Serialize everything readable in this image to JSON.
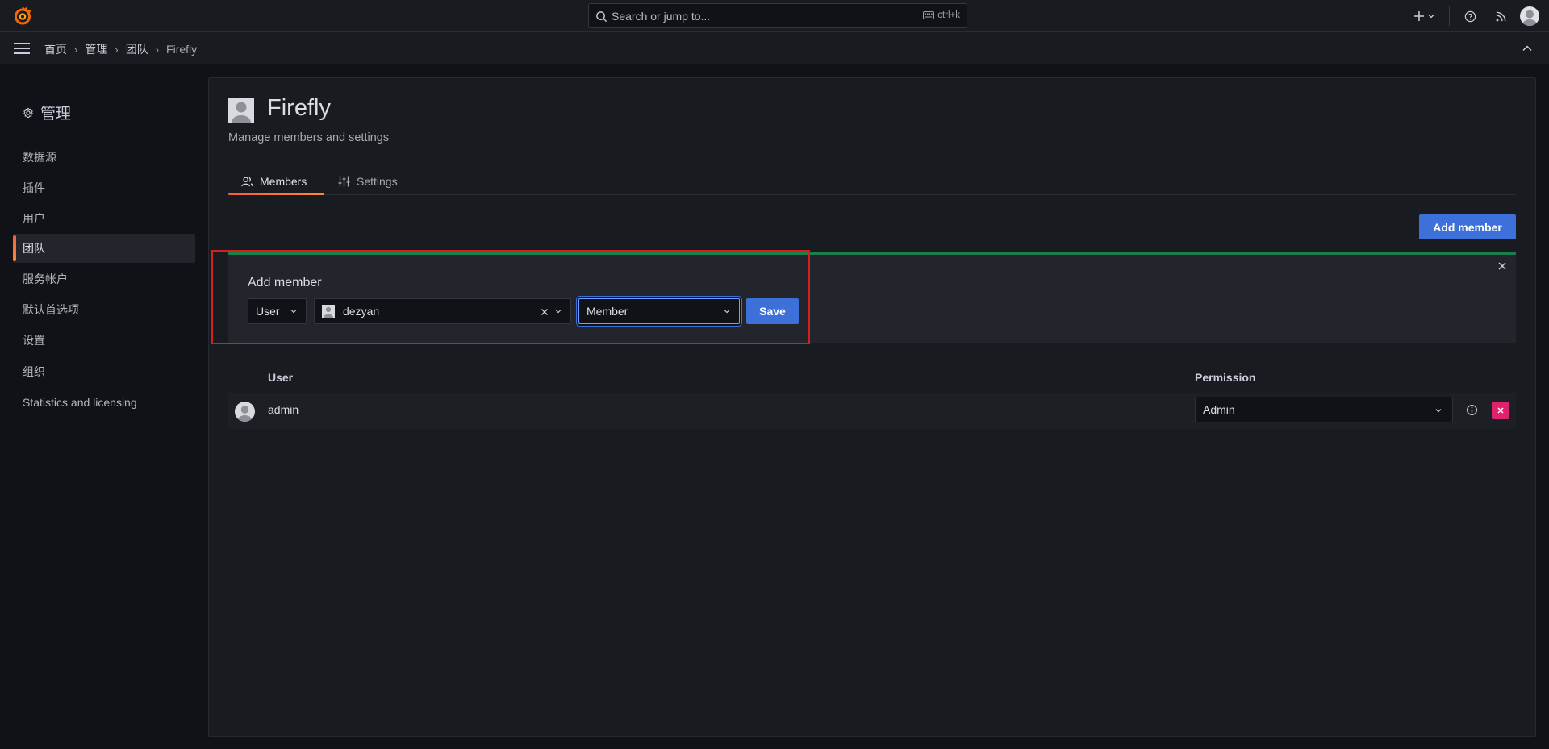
{
  "topbar": {
    "search_placeholder": "Search or jump to...",
    "search_shortcut": "ctrl+k",
    "icons": [
      "grafana-logo-icon",
      "search-icon",
      "keyboard-icon",
      "plus-icon",
      "chevron-down-icon",
      "help-icon",
      "news-feed-icon",
      "user-avatar-icon"
    ]
  },
  "breadcrumb": {
    "items": [
      "首页",
      "管理",
      "团队",
      "Firefly"
    ]
  },
  "sidebar": {
    "title": "管理",
    "items": [
      {
        "label": "数据源",
        "active": false
      },
      {
        "label": "插件",
        "active": false
      },
      {
        "label": "用户",
        "active": false
      },
      {
        "label": "团队",
        "active": true
      },
      {
        "label": "服务帐户",
        "active": false
      },
      {
        "label": "默认首选项",
        "active": false
      },
      {
        "label": "设置",
        "active": false
      },
      {
        "label": "组织",
        "active": false
      },
      {
        "label": "Statistics and licensing",
        "active": false
      }
    ]
  },
  "page": {
    "title": "Firefly",
    "subtitle": "Manage members and settings",
    "tabs": [
      {
        "label": "Members",
        "active": true
      },
      {
        "label": "Settings",
        "active": false
      }
    ],
    "add_member_button": "Add member"
  },
  "add_member_form": {
    "title": "Add member",
    "type_value": "User",
    "user_value": "dezyan",
    "role_value": "Member",
    "save_label": "Save"
  },
  "members_table": {
    "columns": [
      "User",
      "Permission"
    ],
    "rows": [
      {
        "user": "admin",
        "permission": "Admin"
      }
    ]
  },
  "colors": {
    "accent_orange": "#f55f3e",
    "primary_blue": "#3d71d9",
    "success_green": "#1a7f4b",
    "danger_pink": "#e0226e",
    "highlight_red": "#d41f1f"
  }
}
